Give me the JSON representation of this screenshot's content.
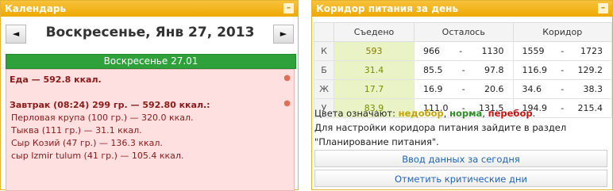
{
  "calendar": {
    "title": "Календарь",
    "collapse_icon": "minus",
    "prev_icon": "◄",
    "next_icon": "►",
    "date_heading": "Воскресенье, Янв 27, 2013",
    "day_header": "Воскресенье 27.01",
    "entries": [
      {
        "text": "Еда — 592.8 ккал.",
        "bold": true
      },
      {
        "text": "Завтрак (08:24) 299 гр. — 592.80 ккал.:",
        "bold": true
      },
      {
        "text": "Перловая крупа (100 гр.) — 320.0 ккал.",
        "bold": false
      },
      {
        "text": "Тыква (111 гр.) — 31.1 ккал.",
        "bold": false
      },
      {
        "text": "Сыр Козий (47 гр.) — 136.3 ккал.",
        "bold": false
      },
      {
        "text": "сыр Izmir tulum (41 гр.) — 105.4 ккал.",
        "bold": false
      }
    ]
  },
  "corridor": {
    "title": "Коридор питания за день",
    "columns": [
      "Съедено",
      "Осталось",
      "Коридор"
    ],
    "rows": [
      {
        "label": "К",
        "eaten": "593",
        "left_from": "966",
        "left_sep": "-",
        "left_to": "1130",
        "cor_from": "1559",
        "cor_sep": "-",
        "cor_to": "1723"
      },
      {
        "label": "Б",
        "eaten": "31.4",
        "left_from": "85.5",
        "left_sep": "-",
        "left_to": "97.8",
        "cor_from": "116.9",
        "cor_sep": "-",
        "cor_to": "129.2"
      },
      {
        "label": "Ж",
        "eaten": "17.7",
        "left_from": "16.9",
        "left_sep": "-",
        "left_to": "20.6",
        "cor_from": "34.6",
        "cor_sep": "-",
        "cor_to": "38.3"
      },
      {
        "label": "У",
        "eaten": "83.9",
        "left_from": "111.0",
        "left_sep": "-",
        "left_to": "131.5",
        "cor_from": "194.9",
        "cor_sep": "-",
        "cor_to": "215.4"
      }
    ],
    "legend_prefix": "Цвета означают:",
    "legend_under": "недобор",
    "legend_norm": "норма",
    "legend_over": "перебор",
    "legend_comma1": ",",
    "legend_comma2": ",",
    "legend_end": ".",
    "settings_line1": "Для настройки коридора питания зайдите в раздел",
    "settings_line2": "\"Планирование питания\".",
    "btn_enter": "Ввод данных за сегодня",
    "btn_critical": "Отметить критические дни",
    "colors": {
      "under": "#c8a400",
      "norm": "#2d8e25",
      "over": "#cc1010",
      "header": "#eea900",
      "day": "#2ea13a"
    }
  }
}
